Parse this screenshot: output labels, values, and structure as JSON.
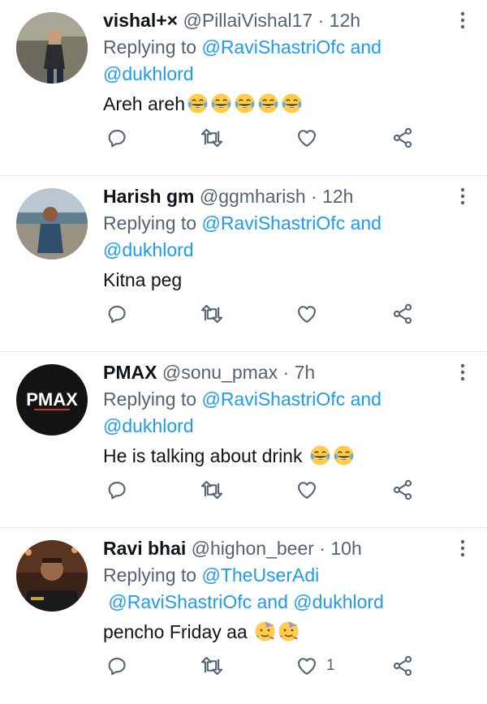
{
  "tweets": [
    {
      "name": "vishal+×",
      "handle": "@PillaiVishal17",
      "time": "12h",
      "replying_prefix": "Replying to",
      "replying_mentions": [
        {
          "text": "@RaviShastriOfc",
          "sep": " and "
        },
        {
          "text": "@dukhlord",
          "sep": ""
        }
      ],
      "text": "Areh areh",
      "emoji": [
        "face-with-tears-of-joy",
        "face-with-tears-of-joy",
        "face-with-tears-of-joy",
        "face-with-tears-of-joy",
        "face-with-tears-of-joy"
      ],
      "like_count": ""
    },
    {
      "name": "Harish gm",
      "handle": "@ggmharish",
      "time": "12h",
      "replying_prefix": "Replying to",
      "replying_mentions": [
        {
          "text": "@RaviShastriOfc",
          "sep": " and "
        },
        {
          "text": "@dukhlord",
          "sep": ""
        }
      ],
      "text": "Kitna peg",
      "emoji": [],
      "like_count": ""
    },
    {
      "name": "PMAX",
      "handle": "@sonu_pmax",
      "time": "7h",
      "replying_prefix": "Replying to",
      "replying_mentions": [
        {
          "text": "@RaviShastriOfc",
          "sep": " and "
        },
        {
          "text": "@dukhlord",
          "sep": ""
        }
      ],
      "text": "He is talking about drink ",
      "emoji": [
        "face-with-tears-of-joy",
        "face-with-tears-of-joy"
      ],
      "like_count": "",
      "avatar_text": "PMAX"
    },
    {
      "name": "Ravi bhai",
      "handle": "@highon_beer",
      "time": "10h",
      "replying_prefix": "Replying to",
      "replying_mentions": [
        {
          "text": "@TheUserAdi",
          "sep": " "
        },
        {
          "text": "@RaviShastriOfc",
          "sep": " and "
        },
        {
          "text": "@dukhlord",
          "sep": ""
        }
      ],
      "text": "pencho Friday aa ",
      "emoji": [
        "partying-face",
        "partying-face"
      ],
      "like_count": "1"
    }
  ],
  "colors": {
    "link": "#1d9bf0",
    "secondary": "#536471",
    "primary": "#0f1419",
    "divider": "#e6ecf0"
  },
  "icons": {
    "reply": "reply-icon",
    "retweet": "retweet-icon",
    "like": "heart-icon",
    "share": "share-icon",
    "more": "more-icon"
  }
}
